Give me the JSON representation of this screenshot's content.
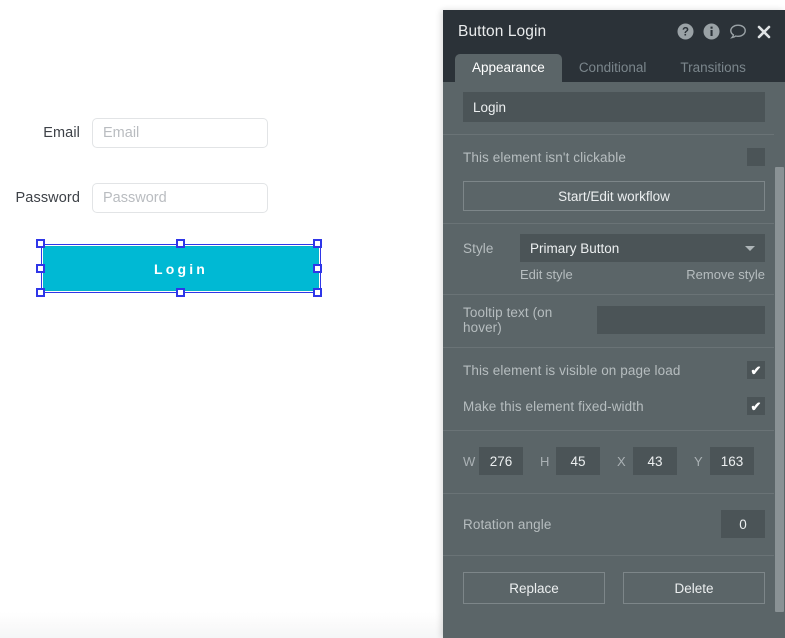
{
  "canvas": {
    "fields": [
      {
        "label": "Email",
        "placeholder": "Email",
        "value": ""
      },
      {
        "label": "Password",
        "placeholder": "Password",
        "value": ""
      }
    ],
    "button": {
      "label": "Login",
      "fill_color": "#00b9d4",
      "text_color": "#ffffff",
      "selected": true,
      "selection_color": "#2f36e8"
    }
  },
  "panel": {
    "title": "Button Login",
    "header_icons": [
      {
        "name": "help-icon",
        "glyph": "?"
      },
      {
        "name": "info-icon",
        "glyph": "i"
      },
      {
        "name": "comment-icon",
        "glyph": "speech-bubble"
      },
      {
        "name": "close-icon",
        "glyph": "x"
      }
    ],
    "tabs": [
      {
        "label": "Appearance",
        "active": true
      },
      {
        "label": "Conditional",
        "active": false
      },
      {
        "label": "Transitions",
        "active": false
      }
    ],
    "caption": {
      "value": "Login",
      "placeholder": ""
    },
    "clickable": {
      "label": "This element isn't clickable",
      "checked": false
    },
    "workflow_button": "Start/Edit workflow",
    "style": {
      "label": "Style",
      "selected": "Primary Button",
      "edit_link": "Edit style",
      "remove_link": "Remove style"
    },
    "tooltip": {
      "label": "Tooltip text (on hover)",
      "value": "",
      "placeholder": ""
    },
    "visible_on_load": {
      "label": "This element is visible on page load",
      "checked": true
    },
    "fixed_width": {
      "label": "Make this element fixed-width",
      "checked": true
    },
    "geometry": [
      {
        "label": "W",
        "value": "276"
      },
      {
        "label": "H",
        "value": "45"
      },
      {
        "label": "X",
        "value": "43"
      },
      {
        "label": "Y",
        "value": "163"
      }
    ],
    "rotation": {
      "label": "Rotation angle",
      "value": "0"
    },
    "actions": {
      "replace": "Replace",
      "delete": "Delete"
    }
  }
}
